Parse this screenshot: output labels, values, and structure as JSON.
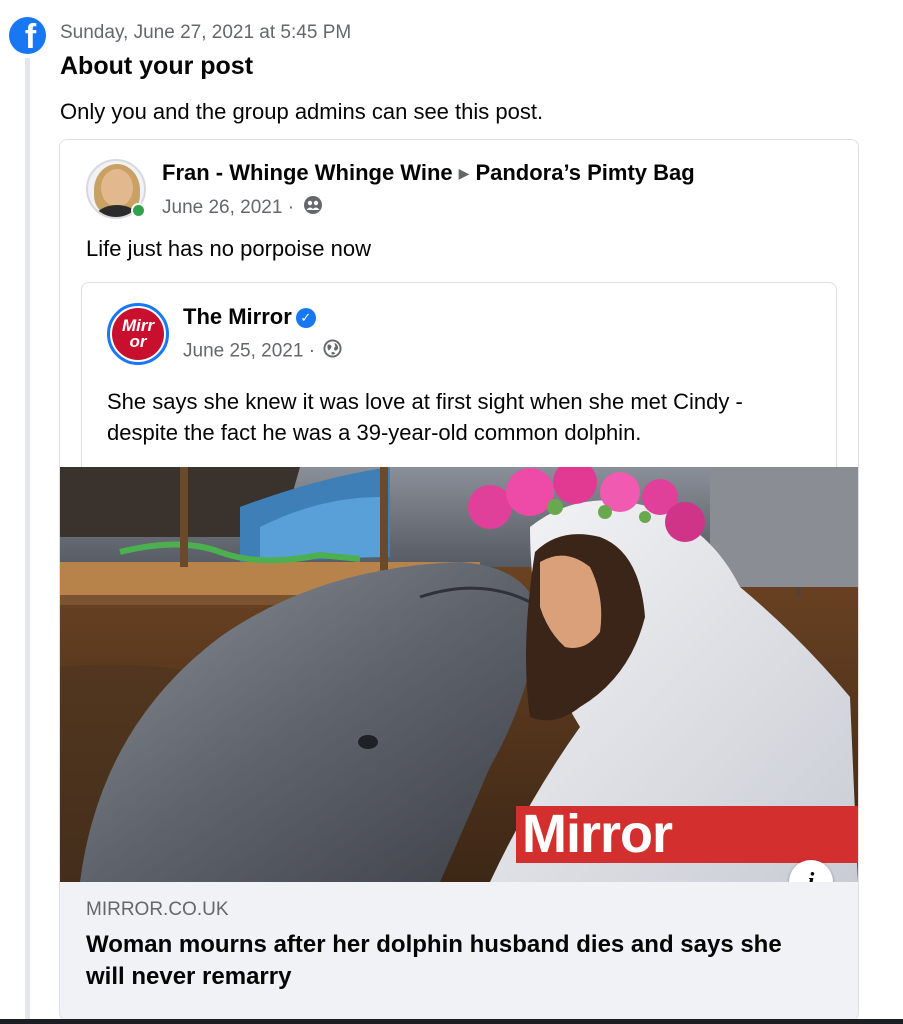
{
  "header": {
    "timestamp": "Sunday, June 27, 2021 at 5:45 PM",
    "title": "About your post",
    "subtitle": "Only you and the group admins can see this post."
  },
  "post": {
    "author": "Fran - Whinge Whinge Wine",
    "group": "Pandora’s Pimty Bag",
    "date": "June 26, 2021 ·",
    "privacy_icon": "group-icon",
    "text": "Life just has no porpoise now"
  },
  "shared_post": {
    "page_name": "The Mirror",
    "logo_text": "Mirr or",
    "date": "June 25, 2021 ·",
    "privacy_icon": "globe-icon",
    "text": "She says she knew it was love at first sight when she met Cindy - despite the fact he was a 39-year-old common dolphin.",
    "image_banner": "Mirror"
  },
  "link": {
    "domain": "MIRROR.CO.UK",
    "headline": "Woman mourns after her dolphin husband dies and says she will never remarry",
    "info_label": "i"
  },
  "colors": {
    "facebook_blue": "#1877f2",
    "mirror_red": "#d32f2f",
    "online_green": "#31a24c"
  }
}
